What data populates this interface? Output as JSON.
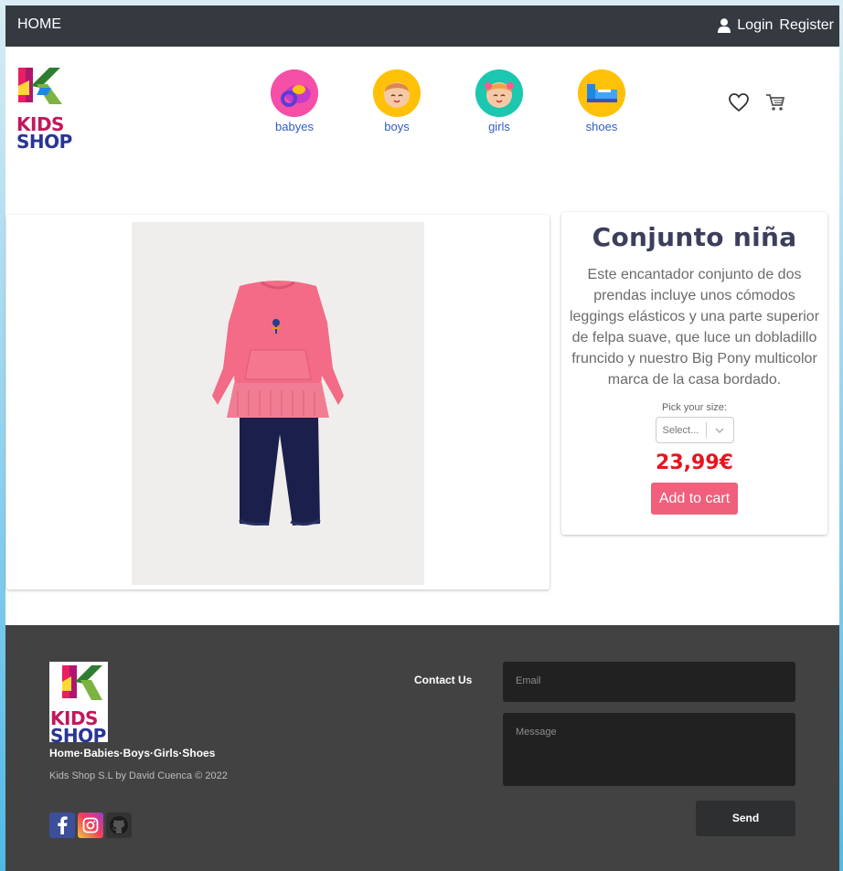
{
  "topbar": {
    "home": "HOME",
    "login": "Login",
    "register": "Register"
  },
  "brand": {
    "line1": "KIDS",
    "line2": "SHOP"
  },
  "categories": [
    {
      "label": "babyes",
      "icon": "pacifier-icon",
      "color": "#f54fa8"
    },
    {
      "label": "boys",
      "icon": "boy-face-icon",
      "color": "#ffc107"
    },
    {
      "label": "girls",
      "icon": "girl-face-icon",
      "color": "#1cc7b0"
    },
    {
      "label": "shoes",
      "icon": "shoe-icon",
      "color": "#ffc107"
    }
  ],
  "header_icons": [
    "heart-icon",
    "cart-icon"
  ],
  "product": {
    "title": "Conjunto niña",
    "description": "Este encantador conjunto de dos prendas incluye unos cómodos leggings elásticos y una parte superior de felpa suave, que luce un dobladillo fruncido y nuestro Big Pony multicolor marca de la casa bordado.",
    "size_label": "Pick your size:",
    "size_placeholder": "Select...",
    "price": "23,99€",
    "add_to_cart": "Add to cart"
  },
  "footer": {
    "links": "Home·Babies·Boys·Girls·Shoes",
    "copyright": "Kids Shop S.L by David Cuenca © 2022",
    "contact_label": "Contact Us",
    "email_placeholder": "Email",
    "message_placeholder": "Message",
    "send": "Send",
    "social": [
      "facebook-icon",
      "instagram-icon",
      "github-icon"
    ]
  },
  "colors": {
    "topbar": "#343a40",
    "footer": "#424242",
    "price": "#e8141d",
    "button": "#f05f7c",
    "title": "#3b3f5c"
  }
}
